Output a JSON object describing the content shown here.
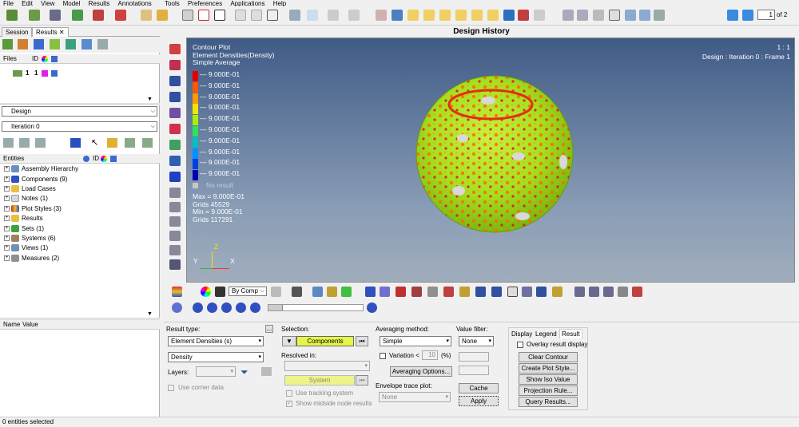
{
  "menu": [
    "File",
    "Edit",
    "View",
    "Model",
    "Results",
    "Annotations",
    "Tools",
    "Preferences",
    "Applications",
    "Help"
  ],
  "page": {
    "current": "1",
    "total": "of 2"
  },
  "left_panel": {
    "tabs": [
      "Session",
      "Results"
    ],
    "files_header": {
      "files": "Files",
      "id": "ID"
    },
    "file_row": {
      "col1": "1",
      "col2": "1"
    },
    "dropdown1": "Design",
    "dropdown2": "Iteration 0",
    "entities_header": {
      "entities": "Entities",
      "id": "ID"
    },
    "tree": [
      "Assembly Hierarchy",
      "Components (9)",
      "Load Cases",
      "Notes (1)",
      "Plot Styles (3)",
      "Results",
      "Sets (1)",
      "Systems (6)",
      "Views (1)",
      "Measures (2)"
    ],
    "props_header": {
      "name": "Name",
      "value": "Value"
    }
  },
  "window_title": "Design History",
  "viewport": {
    "title_lines": [
      "Contour Plot",
      "Element Densities(Density)",
      "Simple Average"
    ],
    "ratio": "1 : 1",
    "frame_info": "Design : Iteration 0 : Frame 1",
    "legend_values": [
      "9.000E-01",
      "9.000E-01",
      "9.000E-01",
      "9.000E-01",
      "9.000E-01",
      "9.000E-01",
      "9.000E-01",
      "9.000E-01",
      "9.000E-01",
      "9.000E-01"
    ],
    "legend_colors": [
      "#e00000",
      "#ff5a00",
      "#ff9900",
      "#f2e600",
      "#a8f000",
      "#30e060",
      "#00c0c0",
      "#0090ff",
      "#0040e0",
      "#0000b0"
    ],
    "no_result": "No result",
    "stats": [
      "Max = 9.000E-01",
      "Grids 45529",
      "Min = 9.000E-01",
      "Grids 117291"
    ],
    "axes": {
      "z": "Z",
      "y": "Y",
      "x": "X"
    }
  },
  "bottom_toolbar": {
    "by_comp": "By Comp"
  },
  "panel": {
    "result_type_label": "Result type:",
    "result_type_value": "Element Densities (s)",
    "density_value": "Density",
    "layers_label": "Layers:",
    "use_corner_data": "Use corner data",
    "selection_label": "Selection:",
    "components_button": "Components",
    "resolved_in_label": "Resolved in:",
    "system_button": "System",
    "use_tracking": "Use tracking system",
    "show_midside": "Show midside node results",
    "averaging_label": "Averaging method:",
    "averaging_value": "Simple",
    "variation_label": "Variation <",
    "variation_value": "10",
    "variation_unit": "(%)",
    "averaging_options": "Averaging Options...",
    "envelope_label": "Envelope trace plot:",
    "envelope_value": "None",
    "value_filter_label": "Value filter:",
    "value_filter_value": "None",
    "cache_button": "Cache",
    "apply_button": "Apply",
    "right_tabs": [
      "Display",
      "Legend",
      "Result"
    ],
    "overlay": "Overlay result display",
    "right_buttons": [
      "Clear Contour",
      "Create Plot Style...",
      "Show Iso Value",
      "Projection Rule...",
      "Query Results..."
    ]
  },
  "status": "0 entities selected"
}
